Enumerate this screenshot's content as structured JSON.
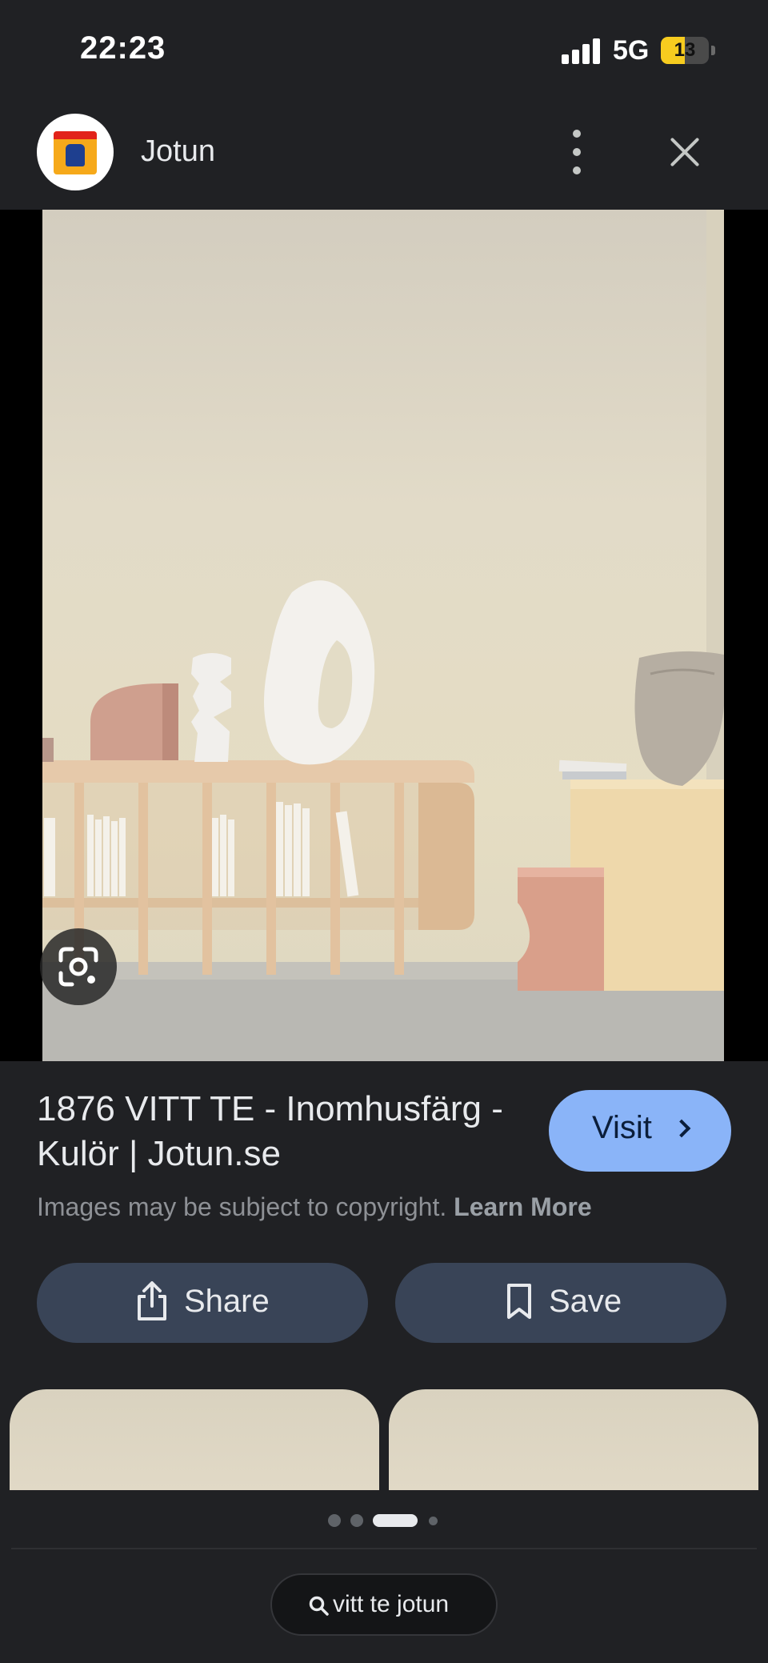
{
  "status_bar": {
    "time": "22:23",
    "network": "5G",
    "battery": "13",
    "battery_level_percent": 13
  },
  "header": {
    "site_name": "Jotun",
    "logo_icon": "jotun-logo-icon",
    "more_icon": "more-vert-icon",
    "close_icon": "close-icon"
  },
  "result": {
    "title": "1876 VITT TE - Inomhusfärg - Kulör | Jotun.se",
    "visit_label": "Visit",
    "copyright_text": "Images may be subject to copyright.",
    "learn_more_label": "Learn More"
  },
  "actions": {
    "share_label": "Share",
    "save_label": "Save"
  },
  "pager": {
    "page_count": 4,
    "active_index": 2
  },
  "search": {
    "query": "vitt te jotun"
  },
  "colors": {
    "background": "#202124",
    "accent": "#8ab4f8",
    "action_button": "#394457",
    "battery": "#f7cc1f"
  }
}
